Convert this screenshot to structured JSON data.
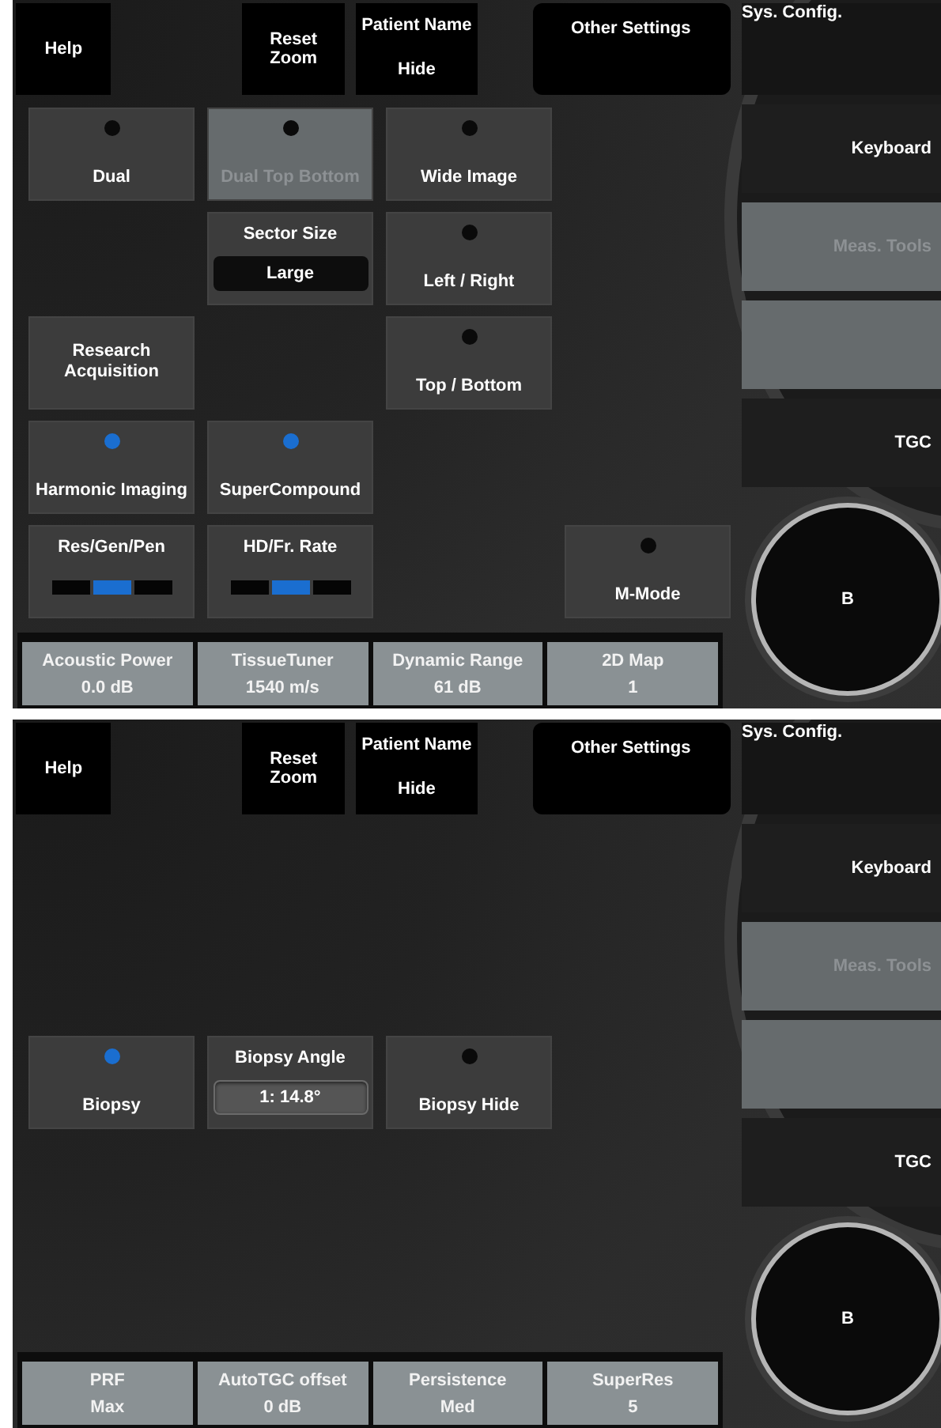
{
  "screens": [
    {
      "top_buttons": [
        {
          "kind": "plain",
          "label": "Help"
        },
        {
          "kind": "plain",
          "label": "Reset Zoom"
        },
        {
          "kind": "valued",
          "label": "Patient Name",
          "value": "Hide"
        },
        {
          "kind": "rounded",
          "label": "Other Settings"
        }
      ],
      "rows": [
        [
          {
            "kind": "toggle",
            "label": "Dual",
            "on": false,
            "disabled": false
          },
          {
            "kind": "toggle",
            "label": "Dual Top Bottom",
            "on": false,
            "disabled": true
          },
          {
            "kind": "toggle",
            "label": "Wide Image",
            "on": false,
            "disabled": false
          },
          {
            "kind": "empty"
          }
        ],
        [
          {
            "kind": "empty"
          },
          {
            "kind": "dropdown",
            "label": "Sector Size",
            "value": "Large"
          },
          {
            "kind": "toggle",
            "label": "Left / Right",
            "on": false,
            "disabled": false
          },
          {
            "kind": "empty"
          }
        ],
        [
          {
            "kind": "action",
            "label": "Research Acquisition"
          },
          {
            "kind": "empty"
          },
          {
            "kind": "toggle",
            "label": "Top / Bottom",
            "on": false,
            "disabled": false
          },
          {
            "kind": "empty"
          }
        ],
        [
          {
            "kind": "toggle",
            "label": "Harmonic Imaging",
            "on": true,
            "disabled": false
          },
          {
            "kind": "toggle",
            "label": "SuperCompound",
            "on": true,
            "disabled": false
          },
          {
            "kind": "empty"
          },
          {
            "kind": "empty"
          }
        ],
        [
          {
            "kind": "segments",
            "label": "Res/Gen/Pen",
            "segments": [
              {
                "selected": false
              },
              {
                "selected": true
              },
              {
                "selected": false
              }
            ]
          },
          {
            "kind": "segments",
            "label": "HD/Fr. Rate",
            "segments": [
              {
                "selected": false
              },
              {
                "selected": true
              },
              {
                "selected": false
              }
            ]
          },
          {
            "kind": "empty"
          },
          {
            "kind": "toggle",
            "label": "M-Mode",
            "on": false,
            "disabled": false
          }
        ]
      ],
      "bottom_params": [
        {
          "label": "Acoustic Power",
          "value": "0.0 dB"
        },
        {
          "label": "TissueTuner",
          "value": "1540 m/s"
        },
        {
          "label": "Dynamic Range",
          "value": "61 dB"
        },
        {
          "label": "2D Map",
          "value": "1"
        }
      ],
      "side_buttons": [
        {
          "label": "Sys. Config.",
          "kind": "top",
          "disabled": false
        },
        {
          "label": "Keyboard",
          "kind": "normal",
          "disabled": false
        },
        {
          "label": "Meas. Tools",
          "kind": "normal",
          "disabled": true
        },
        {
          "kind": "normal",
          "disabled": true
        },
        {
          "label": "TGC",
          "kind": "normal",
          "disabled": false
        }
      ],
      "knob": "B"
    },
    {
      "top_buttons": [
        {
          "kind": "plain",
          "label": "Help"
        },
        {
          "kind": "plain",
          "label": "Reset Zoom"
        },
        {
          "kind": "valued",
          "label": "Patient Name",
          "value": "Hide"
        },
        {
          "kind": "rounded",
          "label": "Other Settings"
        }
      ],
      "rows": [
        [
          {
            "kind": "empty"
          },
          {
            "kind": "empty"
          },
          {
            "kind": "empty"
          },
          {
            "kind": "empty"
          }
        ],
        [
          {
            "kind": "empty"
          },
          {
            "kind": "empty"
          },
          {
            "kind": "empty"
          },
          {
            "kind": "empty"
          }
        ],
        [
          {
            "kind": "toggle",
            "label": "Biopsy",
            "on": true,
            "disabled": false
          },
          {
            "kind": "spinner",
            "label": "Biopsy Angle",
            "value": "1: 14.8°"
          },
          {
            "kind": "toggle",
            "label": "Biopsy Hide",
            "on": false,
            "disabled": false
          },
          {
            "kind": "empty"
          }
        ]
      ],
      "bottom_params": [
        {
          "label": "PRF",
          "value": "Max"
        },
        {
          "label": "AutoTGC offset",
          "value": "0 dB"
        },
        {
          "label": "Persistence",
          "value": "Med"
        },
        {
          "label": "SuperRes",
          "value": "5"
        }
      ],
      "side_buttons": [
        {
          "label": "Sys. Config.",
          "kind": "top",
          "disabled": false
        },
        {
          "label": "Keyboard",
          "kind": "normal",
          "disabled": false
        },
        {
          "label": "Meas. Tools",
          "kind": "normal",
          "disabled": true
        },
        {
          "kind": "normal",
          "disabled": true
        },
        {
          "label": "TGC",
          "kind": "normal",
          "disabled": false
        }
      ],
      "knob": "B"
    }
  ]
}
